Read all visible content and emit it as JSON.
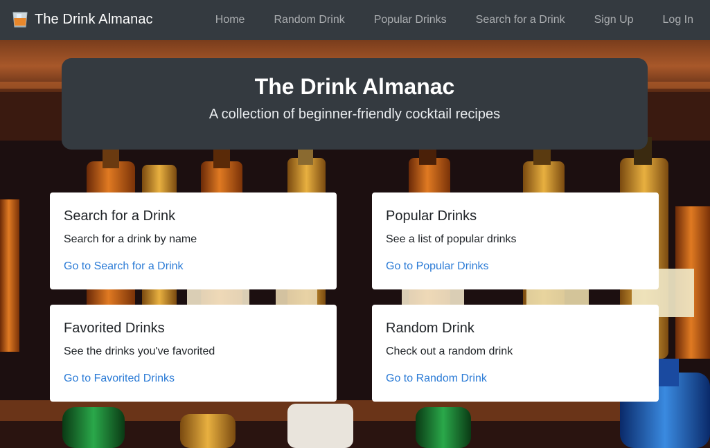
{
  "navbar": {
    "brand": "The Drink Almanac",
    "brand_icon": "whiskey-glass-icon",
    "links": [
      "Home",
      "Random Drink",
      "Popular Drinks",
      "Search for a Drink",
      "Sign Up",
      "Log In"
    ]
  },
  "hero": {
    "title": "The Drink Almanac",
    "subtitle": "A collection of beginner-friendly cocktail recipes"
  },
  "cards": {
    "search": {
      "title": "Search for a Drink",
      "text": "Search for a drink by name",
      "link": "Go to Search for a Drink"
    },
    "popular": {
      "title": "Popular Drinks",
      "text": "See a list of popular drinks",
      "link": "Go to Popular Drinks"
    },
    "favorited": {
      "title": "Favorited Drinks",
      "text": "See the drinks you've favorited",
      "link": "Go to Favorited Drinks"
    },
    "random": {
      "title": "Random Drink",
      "text": "Check out a random drink",
      "link": "Go to Random Drink"
    }
  },
  "colors": {
    "navbar": "#343a40",
    "link": "#2b7bd6",
    "card": "#ffffff"
  }
}
